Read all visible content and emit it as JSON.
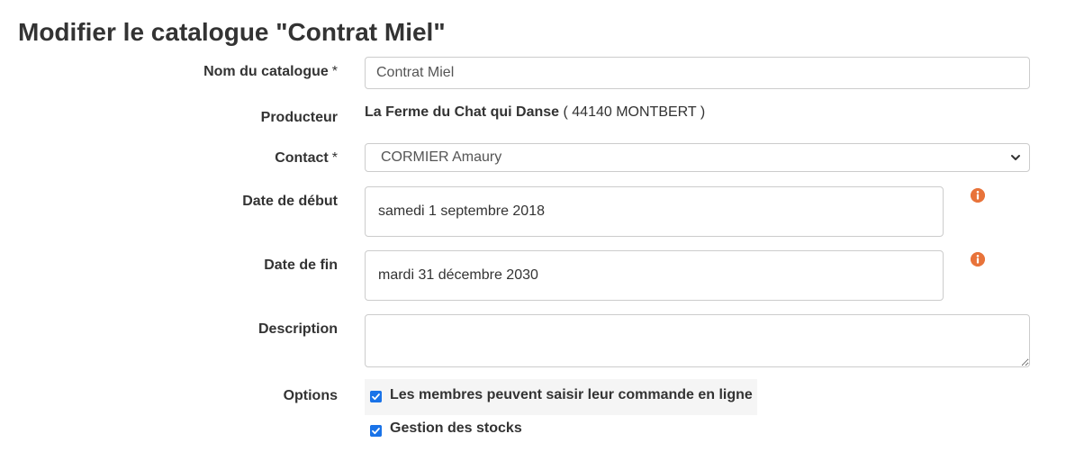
{
  "page": {
    "title": "Modifier le catalogue \"Contrat Miel\""
  },
  "form": {
    "name": {
      "label": "Nom du catalogue",
      "required_mark": "*",
      "value": "Contrat Miel"
    },
    "producer": {
      "label": "Producteur",
      "name": "La Ferme du Chat qui Danse",
      "location": "( 44140 MONTBERT )"
    },
    "contact": {
      "label": "Contact",
      "required_mark": "*",
      "selected": "CORMIER Amaury"
    },
    "start_date": {
      "label": "Date de début",
      "value": "samedi 1 septembre 2018"
    },
    "end_date": {
      "label": "Date de fin",
      "value": "mardi 31 décembre 2030"
    },
    "description": {
      "label": "Description",
      "value": ""
    },
    "options": {
      "label": "Options",
      "items": [
        {
          "label": "Les membres peuvent saisir leur commande en ligne",
          "checked": true
        },
        {
          "label": "Gestion des stocks",
          "checked": true
        }
      ]
    }
  },
  "icons": {
    "info": "info-circle-icon",
    "chevron": "chevron-down-icon",
    "check": "checkmark-icon"
  },
  "colors": {
    "info_icon": "#e8733a",
    "checkbox": "#1a73e8",
    "text": "#333333",
    "border": "#cccccc"
  }
}
